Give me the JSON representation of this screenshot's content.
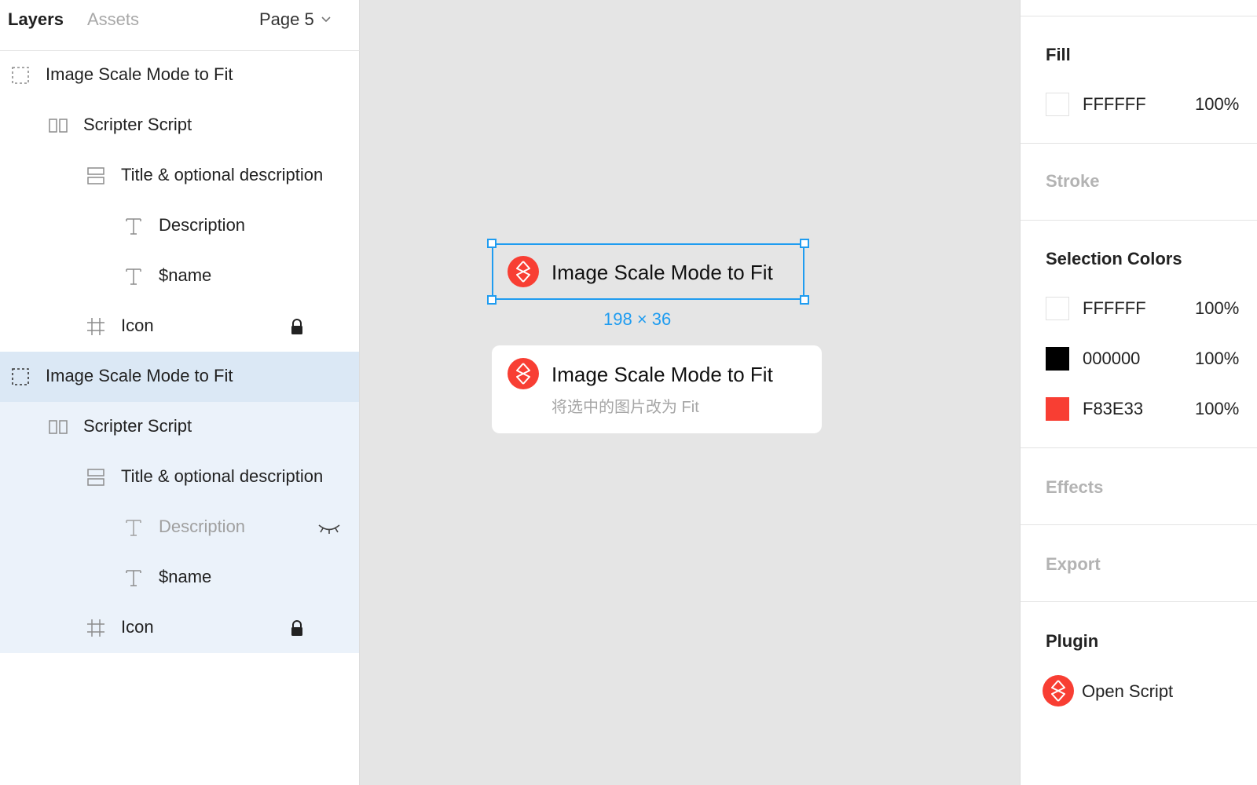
{
  "left_panel": {
    "tabs": {
      "layers": "Layers",
      "assets": "Assets"
    },
    "page_selector": "Page 5",
    "group1": {
      "frame": "Image Scale Mode to Fit",
      "script": "Scripter Script",
      "title_desc": "Title & optional description",
      "description": "Description",
      "name": "$name",
      "icon": "Icon"
    },
    "group2": {
      "frame": "Image Scale Mode to Fit",
      "script": "Scripter Script",
      "title_desc": "Title & optional description",
      "description": "Description",
      "name": "$name",
      "icon": "Icon"
    }
  },
  "canvas": {
    "selected_node_title": "Image Scale Mode to Fit",
    "dimensions": "198 × 36",
    "card2_title": "Image Scale Mode to Fit",
    "card2_description": "将选中的图片改为 Fit"
  },
  "right_panel": {
    "fill": {
      "title": "Fill",
      "hex": "FFFFFF",
      "opacity": "100%",
      "color": "#FFFFFF"
    },
    "stroke_title": "Stroke",
    "selection_colors": {
      "title": "Selection Colors",
      "items": [
        {
          "hex": "FFFFFF",
          "opacity": "100%",
          "color": "#FFFFFF"
        },
        {
          "hex": "000000",
          "opacity": "100%",
          "color": "#000000"
        },
        {
          "hex": "F83E33",
          "opacity": "100%",
          "color": "#F83E33"
        }
      ]
    },
    "effects_title": "Effects",
    "export_title": "Export",
    "plugin": {
      "title": "Plugin",
      "item": "Open Script"
    }
  },
  "colors": {
    "accent": "#1F9CF0",
    "brand": "#F83E33"
  },
  "icons": [
    "chevron-down-icon",
    "frame-icon",
    "component-icon",
    "auto-layout-icon",
    "text-icon",
    "hash-frame-icon",
    "lock-icon",
    "hidden-eye-icon",
    "scripter-logo-icon"
  ]
}
